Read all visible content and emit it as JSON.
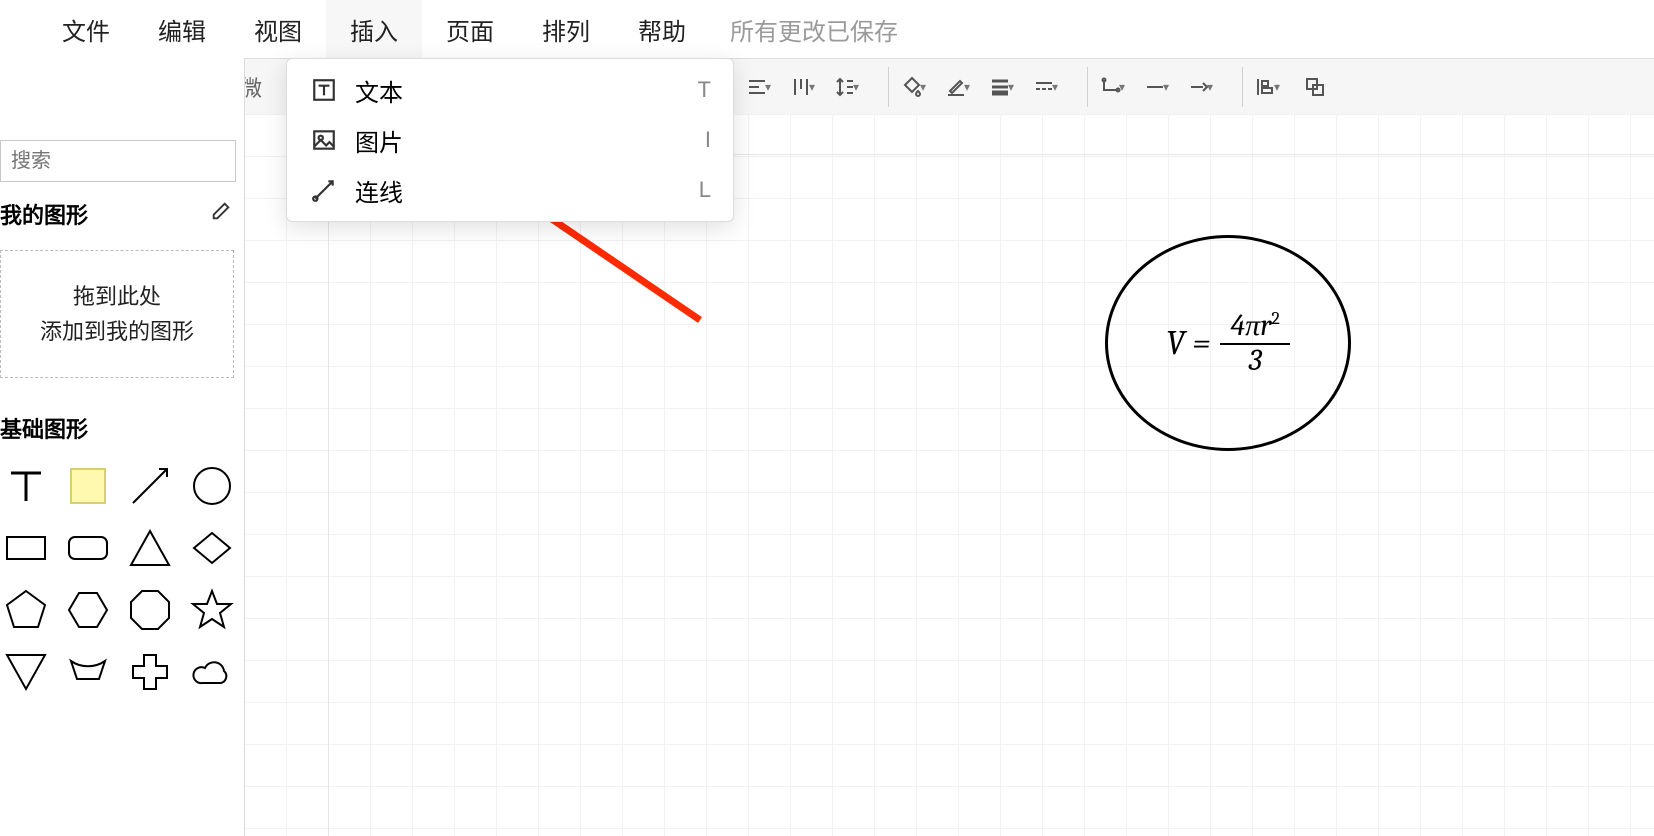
{
  "menubar": {
    "items": [
      "文件",
      "编辑",
      "视图",
      "插入",
      "页面",
      "排列",
      "帮助"
    ],
    "active_index": 3,
    "status": "所有更改已保存"
  },
  "dropdown": {
    "items": [
      {
        "icon": "text-icon",
        "label": "文本",
        "shortcut": "T"
      },
      {
        "icon": "image-icon",
        "label": "图片",
        "shortcut": "I"
      },
      {
        "icon": "line-icon",
        "label": "连线",
        "shortcut": "L"
      }
    ]
  },
  "toolbar": {
    "format_text": "微"
  },
  "sidebar": {
    "search_placeholder": "搜索",
    "my_shapes_header": "我的图形",
    "dropzone_line1": "拖到此处",
    "dropzone_line2": "添加到我的图形",
    "basic_shapes_header": "基础图形"
  },
  "canvas": {
    "formula": {
      "lhs": "V =",
      "numerator_parts": {
        "four": "4",
        "pi": "π",
        "r": "r",
        "exp": "2"
      },
      "denominator": "3"
    }
  }
}
